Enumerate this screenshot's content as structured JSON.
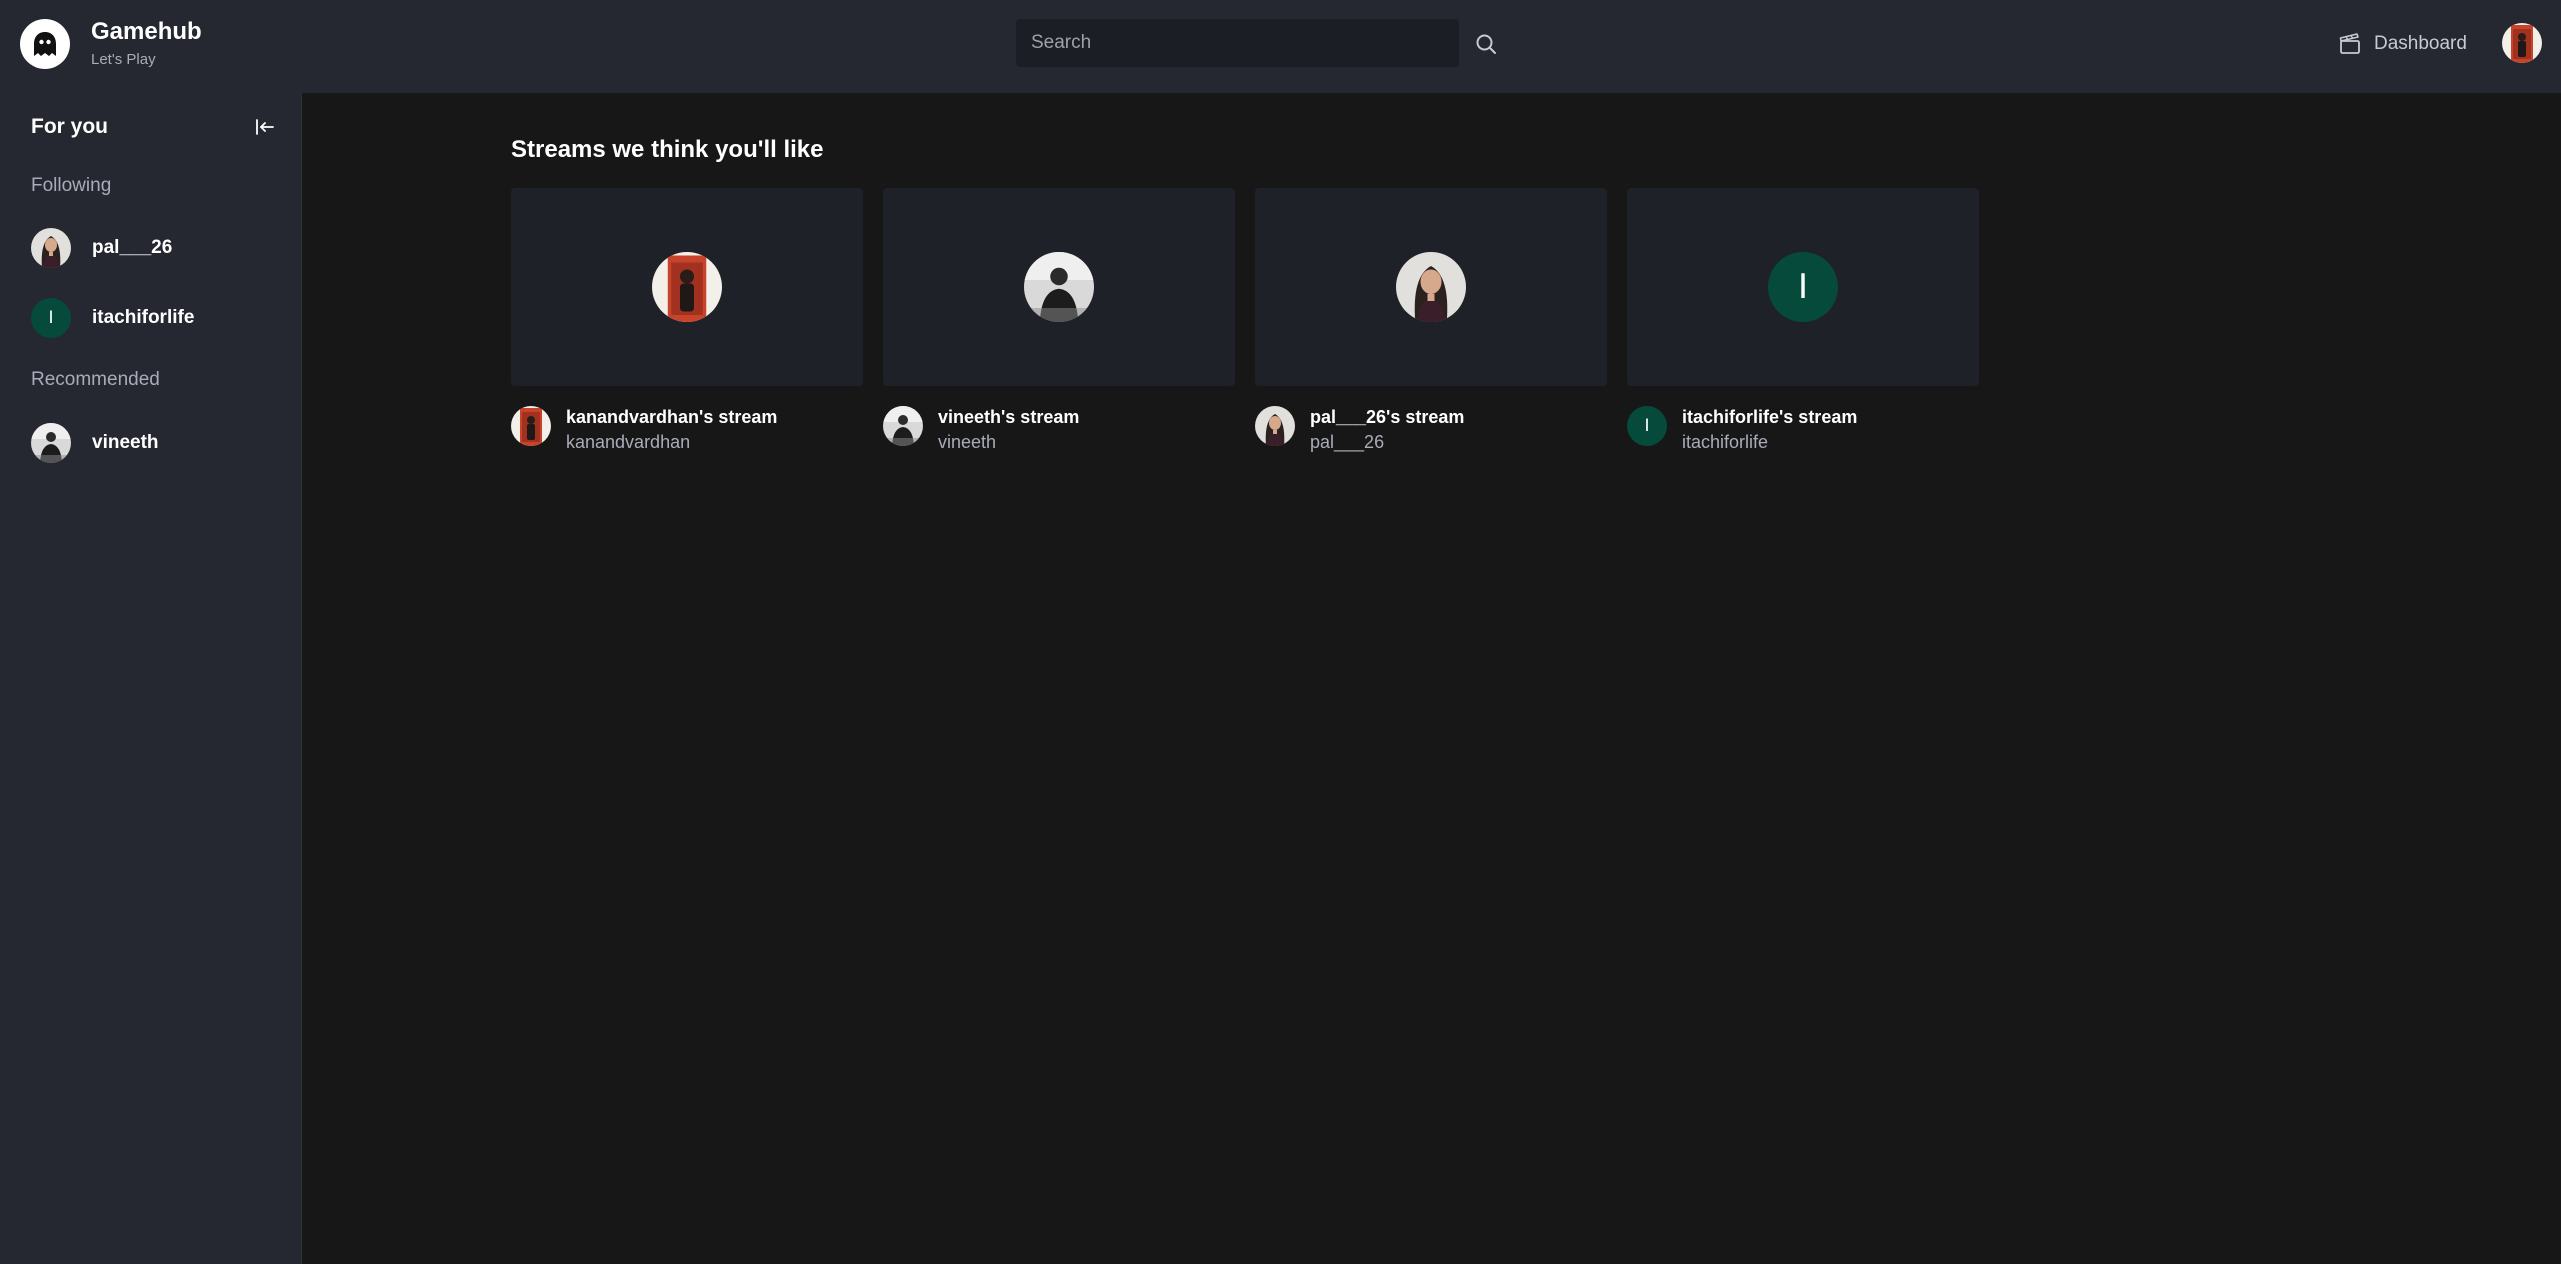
{
  "brand": {
    "title": "Gamehub",
    "subtitle": "Let's Play",
    "icon": "ghost-logo-icon"
  },
  "search": {
    "placeholder": "Search",
    "value": "",
    "icon": "search-icon"
  },
  "header": {
    "dashboard_label": "Dashboard",
    "dashboard_icon": "clapperboard-icon"
  },
  "sidebar": {
    "title": "For you",
    "collapse_icon": "arrow-left-to-line-icon",
    "following_label": "Following",
    "recommended_label": "Recommended",
    "following": [
      {
        "name": "pal___26",
        "avatar": "photo-woman"
      },
      {
        "name": "itachiforlife",
        "avatar": "letter",
        "letter": "I"
      }
    ],
    "recommended": [
      {
        "name": "vineeth",
        "avatar": "photo-man-bw"
      }
    ]
  },
  "main": {
    "heading": "Streams we think you'll like",
    "streams": [
      {
        "title": "kanandvardhan's stream",
        "user": "kanandvardhan",
        "avatar": "photo-red-door"
      },
      {
        "title": "vineeth's stream",
        "user": "vineeth",
        "avatar": "photo-man-bw"
      },
      {
        "title": "pal___26's stream",
        "user": "pal___26",
        "avatar": "photo-woman"
      },
      {
        "title": "itachiforlife's stream",
        "user": "itachiforlife",
        "avatar": "letter",
        "letter": "I"
      }
    ]
  },
  "colors": {
    "background": "#171717",
    "panel": "#252731",
    "card": "#1f2129",
    "letter_avatar": "#054a3a",
    "muted_text": "#a9acb8"
  }
}
